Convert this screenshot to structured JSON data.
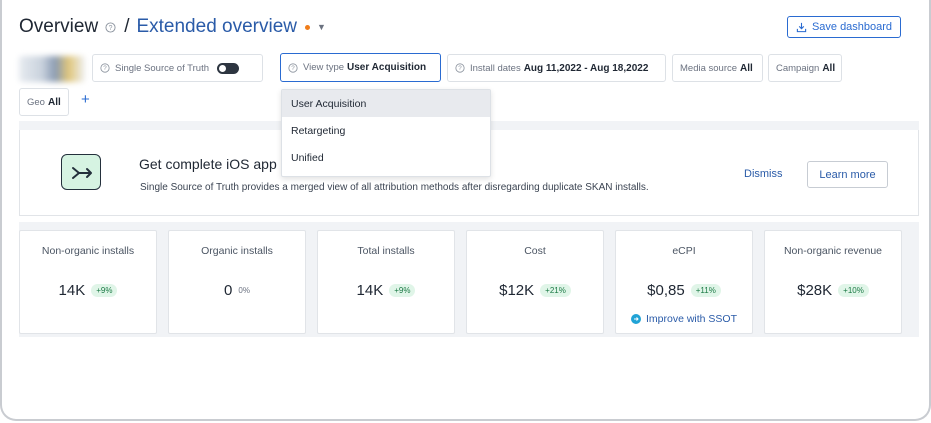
{
  "header": {
    "title": "Overview",
    "separator": "/",
    "subtitle": "Extended overview",
    "save_label": "Save dashboard",
    "accent": "#2a5ba8",
    "dot_color": "#f07d1a"
  },
  "filters": {
    "ssot": {
      "label": "Single Source of Truth"
    },
    "view_type": {
      "label": "View type",
      "value": "User Acquisition"
    },
    "install_dates": {
      "label": "Install dates",
      "value": "Aug 11,2022 - Aug 18,2022"
    },
    "media_source": {
      "label": "Media source",
      "value": "All"
    },
    "campaign": {
      "label": "Campaign",
      "value": "All"
    },
    "geo": {
      "label": "Geo",
      "value": "All"
    },
    "add_label": "+"
  },
  "dropdown": {
    "options": [
      "User Acquisition",
      "Retargeting",
      "Unified"
    ],
    "selected": "User Acquisition"
  },
  "banner": {
    "title": "Get complete iOS app p",
    "text": "Single Source of Truth provides a merged view of all attribution methods after disregarding duplicate SKAN installs.",
    "dismiss_label": "Dismiss",
    "learn_more_label": "Learn more",
    "icon": "merge-arrow-icon"
  },
  "metrics": [
    {
      "label": "Non-organic installs",
      "value": "14K",
      "change": "+9%"
    },
    {
      "label": "Organic installs",
      "value": "0",
      "change": "0%"
    },
    {
      "label": "Total installs",
      "value": "14K",
      "change": "+9%"
    },
    {
      "label": "Cost",
      "value": "$12K",
      "change": "+21%"
    },
    {
      "label": "eCPI",
      "value": "$0,85",
      "change": "+11%",
      "link": "Improve with SSOT"
    },
    {
      "label": "Non-organic revenue",
      "value": "$28K",
      "change": "+10%"
    }
  ]
}
